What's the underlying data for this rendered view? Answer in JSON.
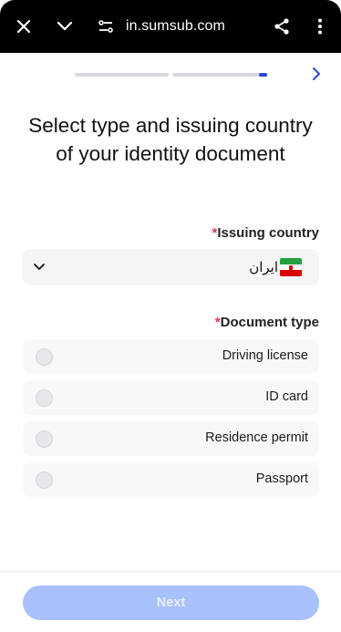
{
  "browser": {
    "url": "in.sumsub.com",
    "icons": [
      "close-icon",
      "chevron-down-icon",
      "tune-icon",
      "share-icon",
      "more-vert-icon"
    ]
  },
  "progress": {
    "steps": 2,
    "current_step": 2,
    "current_step_progress": 0.09,
    "next_icon": "chevron-right-icon"
  },
  "title": "Select type and issuing country of your identity document",
  "issuing_country": {
    "required_mark": "*",
    "label": "Issuing country",
    "value": "ایران",
    "flag": "iran-flag-icon"
  },
  "document_type": {
    "required_mark": "*",
    "label": "Document type",
    "options": [
      {
        "label": "Driving license",
        "selected": false
      },
      {
        "label": "ID card",
        "selected": false
      },
      {
        "label": "Residence permit",
        "selected": false
      },
      {
        "label": "Passport",
        "selected": false
      }
    ]
  },
  "footer": {
    "next_label": "Next",
    "next_enabled": false
  },
  "colors": {
    "accent": "#2b47d6",
    "required": "#d8384d",
    "button_disabled": "#a9c1fb"
  }
}
